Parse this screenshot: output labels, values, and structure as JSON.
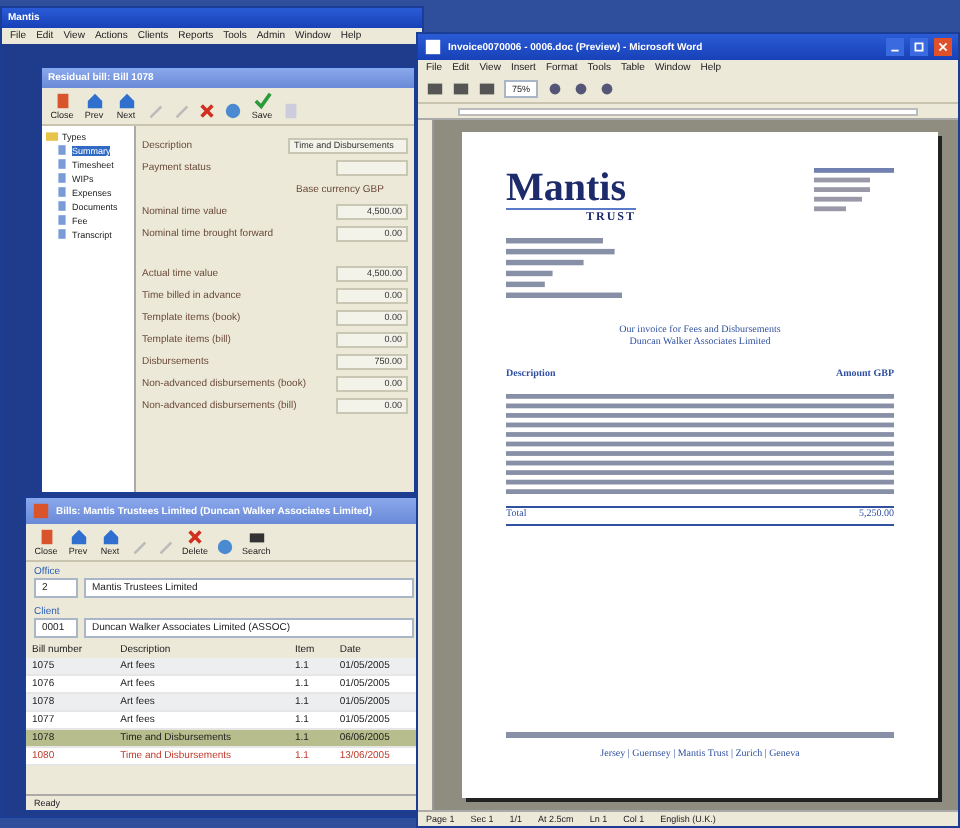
{
  "app_window": {
    "title": "Mantis",
    "menu": [
      "File",
      "Edit",
      "View",
      "Actions",
      "Clients",
      "Reports",
      "Tools",
      "Admin",
      "Window",
      "Help"
    ]
  },
  "bill_window": {
    "title": "Residual bill: Bill 1078",
    "toolbar": [
      {
        "kind": "button",
        "label": "Close"
      },
      {
        "kind": "button",
        "label": "Prev"
      },
      {
        "kind": "button",
        "label": "Next"
      },
      {
        "kind": "icon"
      },
      {
        "kind": "icon"
      },
      {
        "kind": "icon"
      },
      {
        "kind": "icon"
      },
      {
        "kind": "button",
        "label": "Save"
      },
      {
        "kind": "icon"
      }
    ],
    "tree": {
      "label": "Types",
      "children": [
        {
          "label": "Summary",
          "selected": true
        },
        {
          "label": "Timesheet",
          "selected": false
        },
        {
          "label": "WIPs",
          "selected": false
        },
        {
          "label": "Expenses",
          "selected": false
        },
        {
          "label": "Documents",
          "selected": false
        },
        {
          "label": "Fee",
          "selected": false
        },
        {
          "label": "Transcript",
          "selected": false
        }
      ]
    },
    "fields": [
      {
        "kind": "field",
        "label": "Description",
        "value": "Time and Disbursements"
      },
      {
        "kind": "field",
        "label": "Payment status"
      },
      {
        "kind": "heading",
        "label": "Base currency GBP"
      },
      {
        "kind": "field",
        "label": "Nominal time value",
        "value": "4,500.00"
      },
      {
        "kind": "field",
        "label": "Nominal time brought forward",
        "value": "0.00"
      },
      {
        "kind": "gap"
      },
      {
        "kind": "field",
        "label": "Actual time value",
        "value": "4,500.00"
      },
      {
        "kind": "field",
        "label": "Time billed in advance",
        "value": "0.00"
      },
      {
        "kind": "field",
        "label": "Template items (book)",
        "value": "0.00"
      },
      {
        "kind": "field",
        "label": "Template items (bill)",
        "value": "0.00"
      },
      {
        "kind": "field",
        "label": "Disbursements",
        "value": "750.00"
      },
      {
        "kind": "field",
        "label": "Non-advanced disbursements (book)",
        "value": "0.00"
      },
      {
        "kind": "field",
        "label": "Non-advanced disbursements (bill)",
        "value": "0.00"
      }
    ]
  },
  "bills_window": {
    "title": "Bills: Mantis Trustees Limited (Duncan Walker Associates Limited)",
    "toolbar": [
      {
        "kind": "button",
        "label": "Close"
      },
      {
        "kind": "button",
        "label": "Prev"
      },
      {
        "kind": "button",
        "label": "Next"
      },
      {
        "kind": "icon"
      },
      {
        "kind": "icon"
      },
      {
        "kind": "button",
        "label": "Delete"
      },
      {
        "kind": "icon"
      },
      {
        "kind": "button",
        "label": "Search"
      }
    ],
    "office": {
      "label": "Office",
      "code": "2",
      "name": "Mantis Trustees Limited"
    },
    "client": {
      "label": "Client",
      "code": "0001",
      "name": "Duncan Walker Associates Limited (ASSOC)"
    },
    "table": {
      "columns": [
        "Bill number",
        "Description",
        "Item",
        "Date"
      ],
      "rows": [
        {
          "cells": [
            "1075",
            "Art fees",
            "1.1",
            "01/05/2005"
          ],
          "selected": false,
          "unpaid": false
        },
        {
          "cells": [
            "1076",
            "Art fees",
            "1.1",
            "01/05/2005"
          ],
          "selected": false,
          "unpaid": false
        },
        {
          "cells": [
            "1078",
            "Art fees",
            "1.1",
            "01/05/2005"
          ],
          "selected": false,
          "unpaid": false
        },
        {
          "cells": [
            "1077",
            "Art fees",
            "1.1",
            "01/05/2005"
          ],
          "selected": false,
          "unpaid": false
        },
        {
          "cells": [
            "1078",
            "Time and Disbursements",
            "1.1",
            "06/06/2005"
          ],
          "selected": true,
          "unpaid": false
        },
        {
          "cells": [
            "1080",
            "Time and Disbursements",
            "1.1",
            "13/06/2005"
          ],
          "selected": false,
          "unpaid": true
        }
      ]
    },
    "status": "Ready"
  },
  "word_window": {
    "title": "Invoice0070006 - 0006.doc (Preview) - Microsoft Word",
    "menu": [
      "File",
      "Edit",
      "View",
      "Insert",
      "Format",
      "Tools",
      "Table",
      "Window",
      "Help"
    ],
    "zoom": "75%",
    "document": {
      "logo": "Mantis",
      "logo_sub": "TRUST",
      "heading": "Our invoice for Fees and Disbursements",
      "subheading": "Duncan Walker Associates Limited",
      "col_description": "Description",
      "col_amount": "Amount GBP",
      "total_label": "Total",
      "total": "5,250.00",
      "footer_links": "Jersey | Guernsey | Mantis Trust | Zurich | Geneva"
    },
    "status_bar": [
      "Page 1",
      "Sec 1",
      "1/1",
      "At 2.5cm",
      "Ln 1",
      "Col 1",
      "English (U.K.)"
    ]
  }
}
